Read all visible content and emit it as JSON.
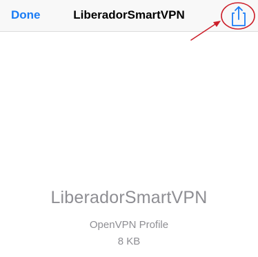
{
  "navbar": {
    "done_label": "Done",
    "title": "LiberadorSmartVPN",
    "share_icon": "share-icon"
  },
  "file": {
    "name": "LiberadorSmartVPN",
    "type": "OpenVPN Profile",
    "size": "8 KB"
  },
  "colors": {
    "accent": "#1a7cf5",
    "annotation": "#cc1f2a",
    "secondary_text": "#8e8e93"
  }
}
